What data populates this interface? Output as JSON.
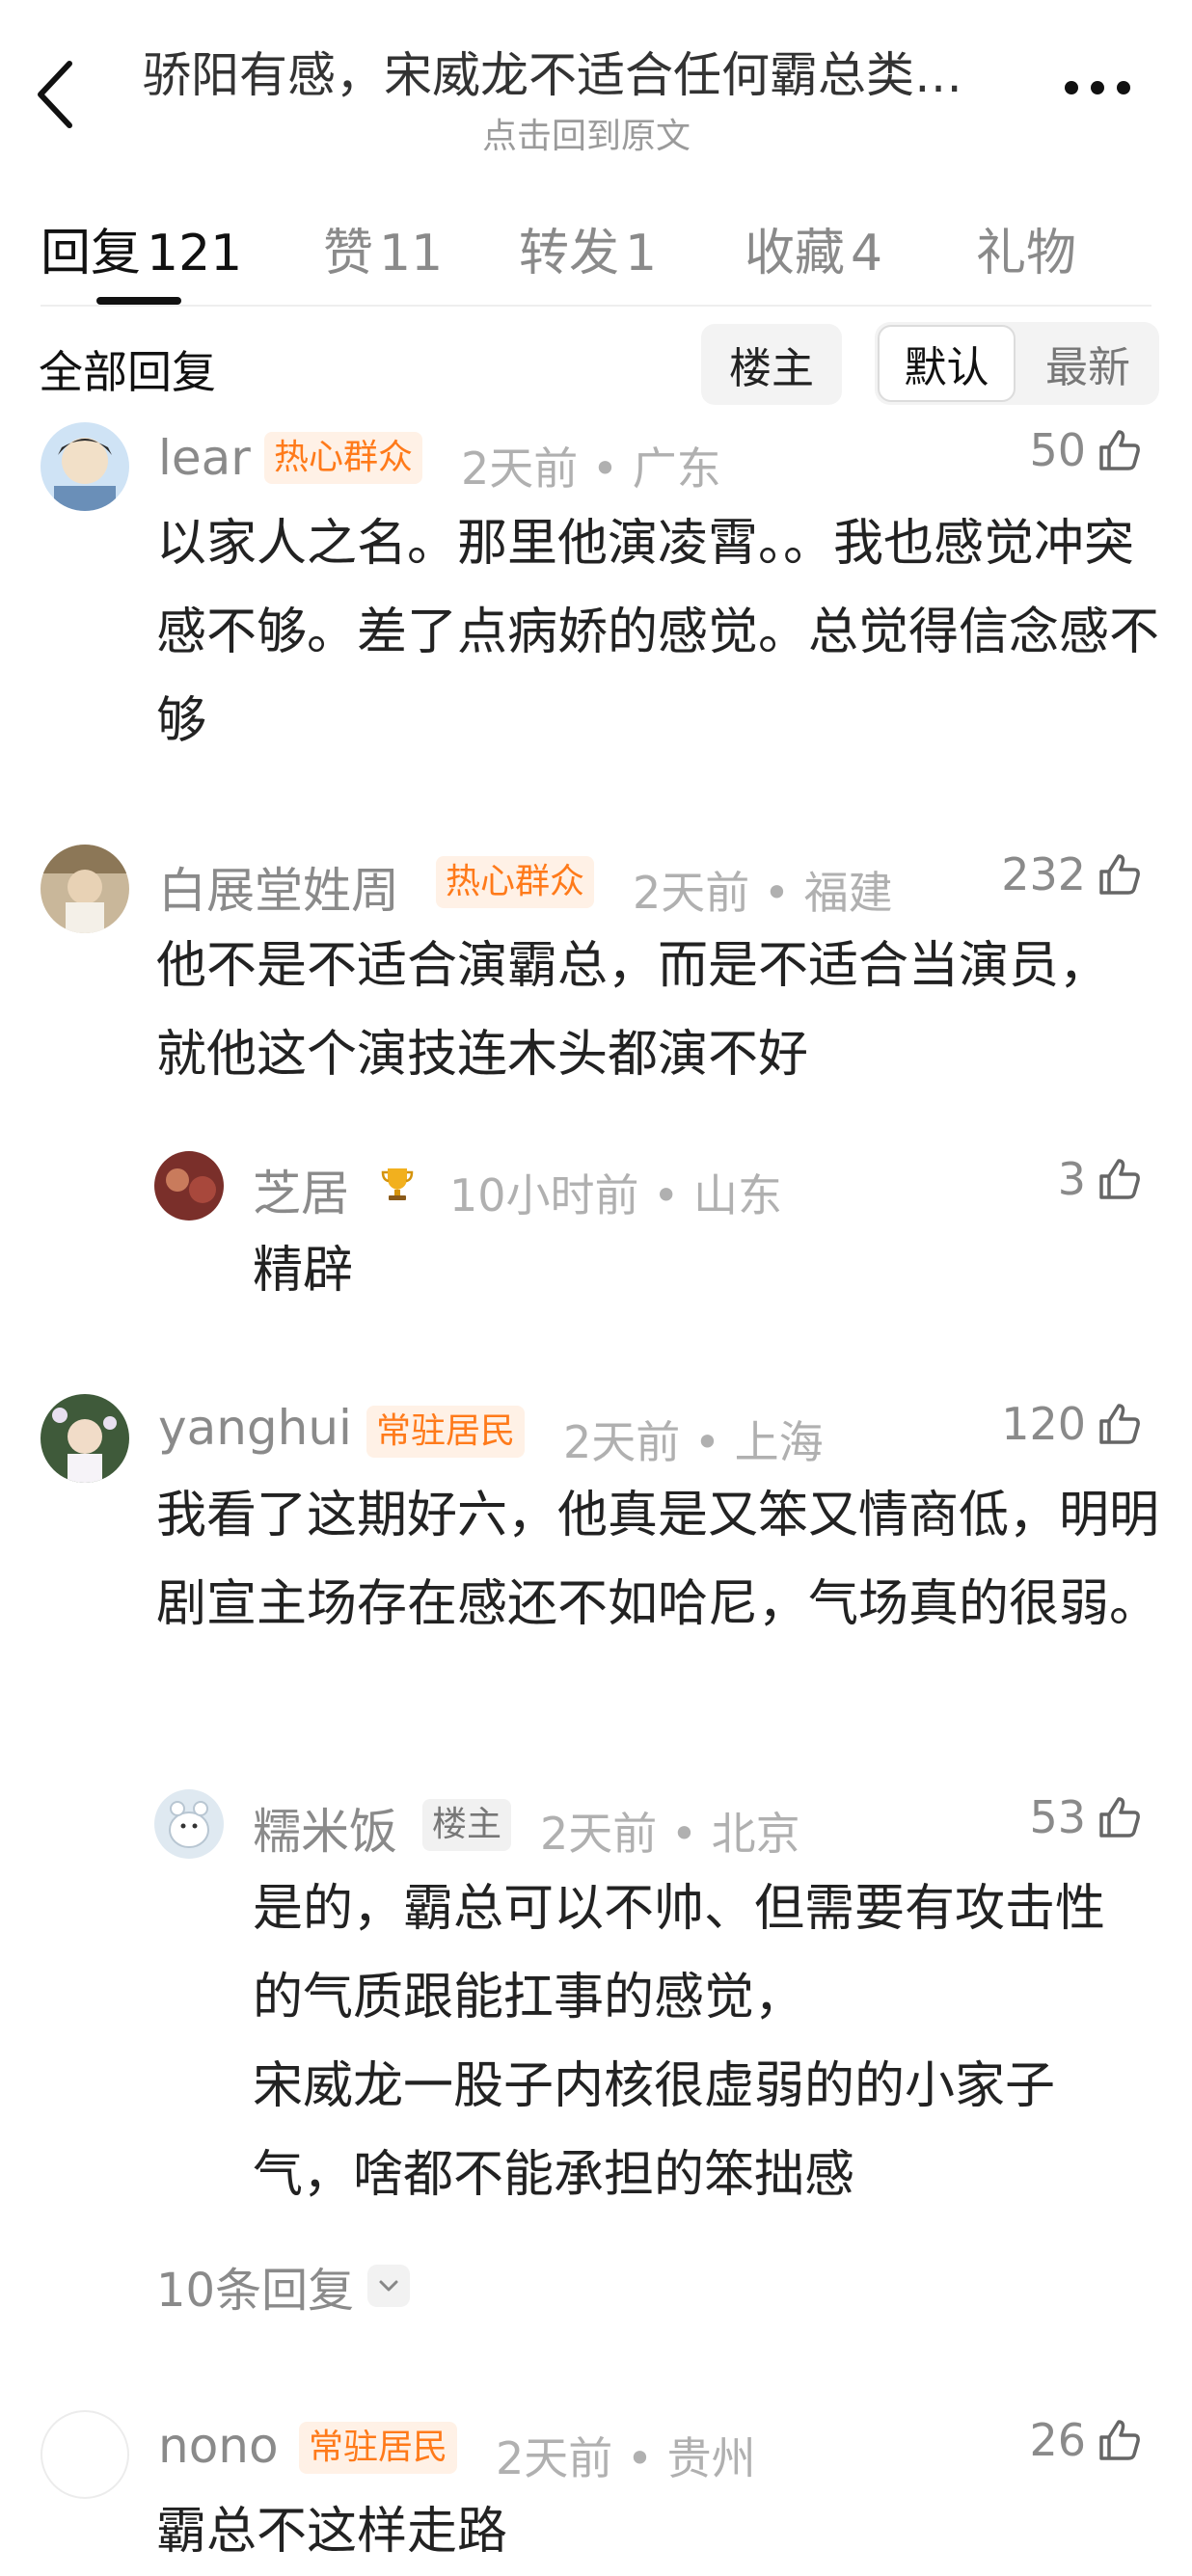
{
  "header": {
    "title": "骄阳有感，宋威龙不适合任何霸总类…",
    "subtitle": "点击回到原文"
  },
  "tabs": [
    {
      "label": "回复",
      "count": "121",
      "active": true
    },
    {
      "label": "赞",
      "count": "11"
    },
    {
      "label": "转发",
      "count": "1"
    },
    {
      "label": "收藏",
      "count": "4"
    },
    {
      "label": "礼物",
      "count": ""
    }
  ],
  "filter": {
    "all_label": "全部回复",
    "op_button": "楼主",
    "sort_default": "默认",
    "sort_new": "最新"
  },
  "comments": [
    {
      "username": "lear",
      "badge": "热心群众",
      "time": "2天前",
      "location": "广东",
      "likes": "50",
      "text": "以家人之名。那里他演凌霄。。我也感觉冲突感不够。差了点病娇的感觉。总觉得信念感不够"
    },
    {
      "username": "白展堂姓周",
      "badge": "热心群众",
      "time": "2天前",
      "location": "福建",
      "likes": "232",
      "text": "他不是不适合演霸总，而是不适合当演员，就他这个演技连木头都演不好",
      "replies": [
        {
          "username": "芝居",
          "icon": "trophy-icon",
          "time": "10小时前",
          "location": "山东",
          "likes": "3",
          "text": "精辟"
        }
      ]
    },
    {
      "username": "yanghui",
      "badge": "常驻居民",
      "time": "2天前",
      "location": "上海",
      "likes": "120",
      "text": "我看了这期好六，他真是又笨又情商低，明明剧宣主场存在感还不如哈尼，气场真的很弱。",
      "replies": [
        {
          "username": "糯米饭",
          "badge": "楼主",
          "time": "2天前",
          "location": "北京",
          "likes": "53",
          "text": "是的，霸总可以不帅、但需要有攻击性的气质跟能扛事的感觉，\n宋威龙一股子内核很虚弱的的小家子气，啥都不能承担的笨拙感"
        }
      ],
      "more_replies": "10条回复"
    },
    {
      "username": "nono",
      "badge": "常驻居民",
      "time": "2天前",
      "location": "贵州",
      "likes": "26",
      "text": "霸总不这样走路"
    }
  ],
  "colors": {
    "badge_text": "#ff7a1a",
    "badge_bg": "#fff1e6",
    "meta_gray": "#b0b0b0"
  }
}
